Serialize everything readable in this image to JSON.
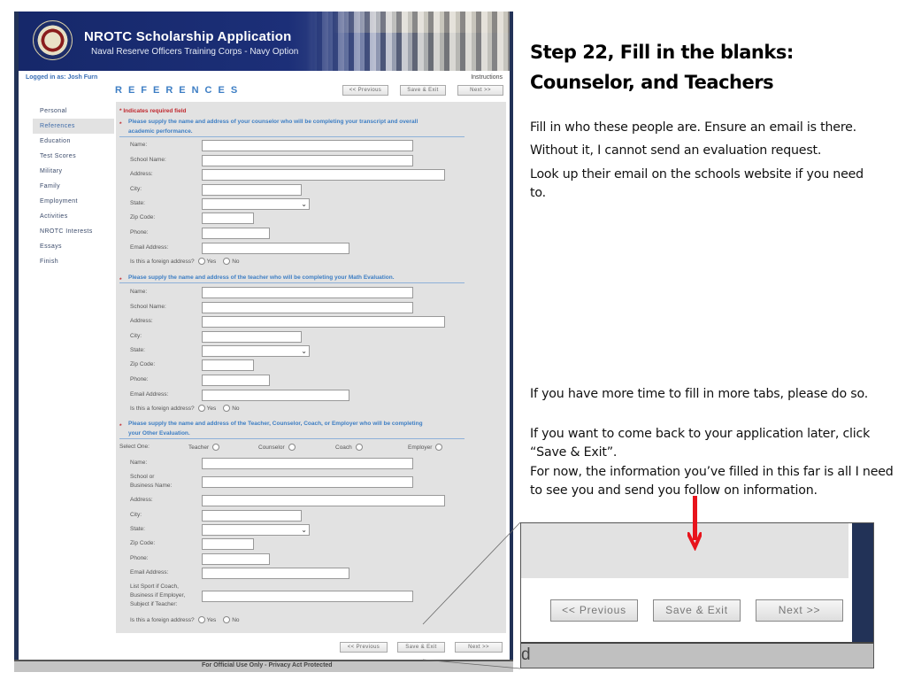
{
  "app": {
    "title": "NROTC Scholarship Application",
    "subtitle": "Naval Reserve Officers Training Corps - Navy Option",
    "logged_in": "Logged in as: Josh Furn",
    "instructions_link": "Instructions",
    "page_heading": "REFERENCES",
    "nav_buttons": {
      "previous": "<< Previous",
      "save_exit": "Save & Exit",
      "next": "Next >>"
    },
    "footer": "For Official Use Only - Privacy Act Protected",
    "brand_color": "#1c2f78",
    "accent_color": "#3d7ec4",
    "required_color": "#c0282e"
  },
  "sidebar": {
    "active": "References",
    "items": [
      {
        "label": "Personal"
      },
      {
        "label": "References"
      },
      {
        "label": "Education"
      },
      {
        "label": "Test Scores"
      },
      {
        "label": "Military"
      },
      {
        "label": "Family"
      },
      {
        "label": "Employment"
      },
      {
        "label": "Activities"
      },
      {
        "label": "NROTC Interests"
      },
      {
        "label": "Essays"
      },
      {
        "label": "Finish"
      }
    ]
  },
  "form": {
    "required_note": "Indicates required field",
    "required_star": "*",
    "state_chevron": "⌄",
    "sections": [
      {
        "heading_line1": "Please supply the name and address of your counselor who will be completing your transcript and overall",
        "heading_line2": "academic performance.",
        "labels": {
          "name": "Name:",
          "school": "School Name:",
          "address": "Address:",
          "city": "City:",
          "state": "State:",
          "zip": "Zip Code:",
          "phone": "Phone:",
          "email": "Email Address:"
        },
        "values": {
          "name": "",
          "school": "",
          "address": "",
          "city": "",
          "state": "",
          "zip": "",
          "phone": "",
          "email": ""
        },
        "foreign_q": "Is this a foreign address?",
        "yes": "Yes",
        "no": "No"
      },
      {
        "heading_line1": "Please supply the name and address of the teacher who will be completing your Math Evaluation.",
        "labels": {
          "name": "Name:",
          "school": "School Name:",
          "address": "Address:",
          "city": "City:",
          "state": "State:",
          "zip": "Zip Code:",
          "phone": "Phone:",
          "email": "Email Address:"
        },
        "values": {
          "name": "",
          "school": "",
          "address": "",
          "city": "",
          "state": "",
          "zip": "",
          "phone": "",
          "email": ""
        },
        "foreign_q": "Is this a foreign address?",
        "yes": "Yes",
        "no": "No"
      },
      {
        "heading_line1": "Please supply the name and address of the Teacher, Counselor, Coach, or Employer who will be completing",
        "heading_line2": "your Other Evaluation.",
        "select_one": "Select One:",
        "options": [
          "Teacher",
          "Counselor",
          "Coach",
          "Employer"
        ],
        "labels": {
          "name": "Name:",
          "school_1": "School or",
          "school_2": "Business Name:",
          "address": "Address:",
          "city": "City:",
          "state": "State:",
          "zip": "Zip Code:",
          "phone": "Phone:",
          "email": "Email Address:",
          "sport_1": "List Sport if Coach,",
          "sport_2": "Business if Employer,",
          "sport_3": "Subject if Teacher:"
        },
        "values": {
          "name": "",
          "school": "",
          "address": "",
          "city": "",
          "state": "",
          "zip": "",
          "phone": "",
          "email": "",
          "sport": ""
        },
        "foreign_q": "Is this a foreign address?",
        "yes": "Yes",
        "no": "No"
      }
    ]
  },
  "annotation": {
    "title_line1": "Step 22, Fill in the blanks:",
    "title_line2": "Counselor, and Teachers",
    "notes_top": [
      "Fill in who these people are.  Ensure an email is there.",
      "Without it, I cannot send an evaluation request.",
      "Look up their email on the schools website if you need to."
    ],
    "notes_bottom": [
      "If you have more time to fill in more tabs, please do so.",
      "If you want to come back to your application later, click “Save & Exit”.",
      "For now, the information you’ve filled in this far is all I need to see you and send you follow on information."
    ],
    "arrow_color": "#e8141c"
  },
  "callout": {
    "previous": "<< Previous",
    "save_exit": "Save & Exit",
    "next": "Next >>",
    "footer_fragment": "d"
  }
}
